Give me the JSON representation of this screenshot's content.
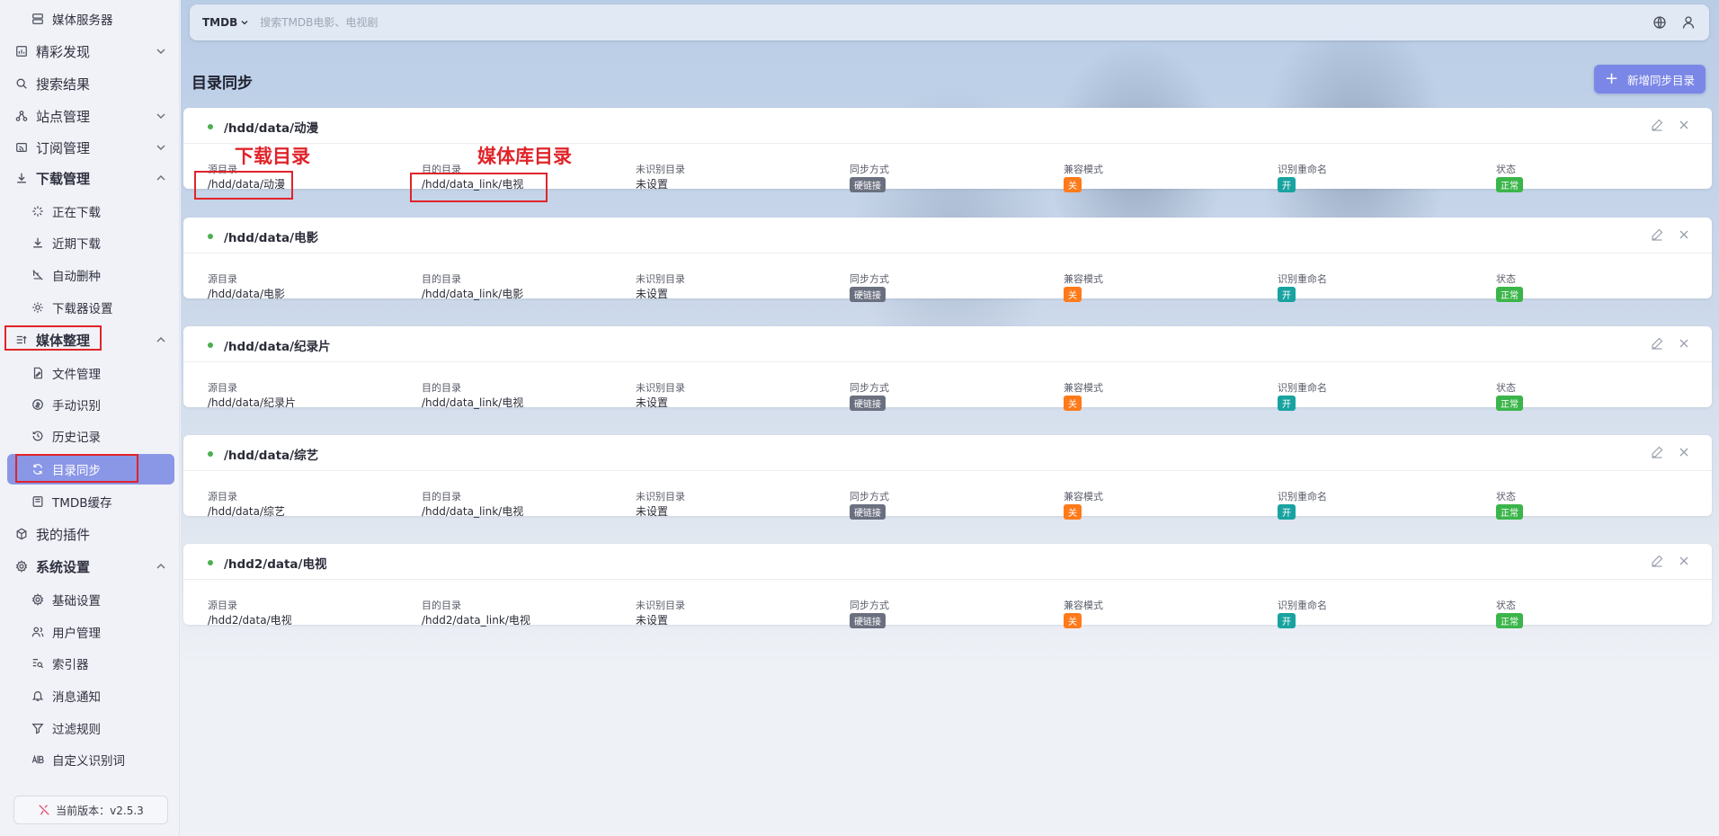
{
  "sidebar": {
    "items": [
      {
        "label": "媒体服务器",
        "icon": "server-icon"
      },
      {
        "label": "精彩发现",
        "icon": "chart-icon"
      },
      {
        "label": "搜索结果",
        "icon": "search-icon"
      },
      {
        "label": "站点管理",
        "icon": "sitemap-icon"
      },
      {
        "label": "订阅管理",
        "icon": "rss-icon"
      },
      {
        "label": "下载管理",
        "icon": "download-icon"
      },
      {
        "label": "正在下载",
        "icon": "loader-icon"
      },
      {
        "label": "近期下载",
        "icon": "download-icon"
      },
      {
        "label": "自动删种",
        "icon": "auto-delete-icon"
      },
      {
        "label": "下载器设置",
        "icon": "downloader-settings-icon"
      },
      {
        "label": "媒体整理",
        "icon": "organize-icon"
      },
      {
        "label": "文件管理",
        "icon": "file-edit-icon"
      },
      {
        "label": "手动识别",
        "icon": "identify-icon"
      },
      {
        "label": "历史记录",
        "icon": "history-icon"
      },
      {
        "label": "目录同步",
        "icon": "sync-icon"
      },
      {
        "label": "TMDB缓存",
        "icon": "cache-icon"
      },
      {
        "label": "我的插件",
        "icon": "plugin-icon"
      },
      {
        "label": "系统设置",
        "icon": "settings-icon"
      },
      {
        "label": "基础设置",
        "icon": "gear-icon"
      },
      {
        "label": "用户管理",
        "icon": "users-icon"
      },
      {
        "label": "索引器",
        "icon": "indexer-icon"
      },
      {
        "label": "消息通知",
        "icon": "bell-icon"
      },
      {
        "label": "过滤规则",
        "icon": "filter-icon"
      },
      {
        "label": "自定义识别词",
        "icon": "ab-icon"
      }
    ],
    "version": "当前版本：v2.5.3"
  },
  "header": {
    "source_select": "TMDB",
    "search_placeholder": "搜索TMDB电影、电视剧"
  },
  "page": {
    "title": "目录同步",
    "add_button": "新增同步目录"
  },
  "field_labels": {
    "source": "源目录",
    "dest": "目的目录",
    "unknown": "未识别目录",
    "sync_mode": "同步方式",
    "compat": "兼容模式",
    "rename": "识别重命名",
    "status": "状态"
  },
  "cards": [
    {
      "title": "/hdd/data/动漫",
      "source": "/hdd/data/动漫",
      "dest": "/hdd/data_link/电视",
      "unknown": "未设置",
      "sync_mode": "硬链接",
      "compat": "关",
      "rename": "开",
      "status": "正常"
    },
    {
      "title": "/hdd/data/电影",
      "source": "/hdd/data/电影",
      "dest": "/hdd/data_link/电影",
      "unknown": "未设置",
      "sync_mode": "硬链接",
      "compat": "关",
      "rename": "开",
      "status": "正常"
    },
    {
      "title": "/hdd/data/纪录片",
      "source": "/hdd/data/纪录片",
      "dest": "/hdd/data_link/电视",
      "unknown": "未设置",
      "sync_mode": "硬链接",
      "compat": "关",
      "rename": "开",
      "status": "正常"
    },
    {
      "title": "/hdd/data/综艺",
      "source": "/hdd/data/综艺",
      "dest": "/hdd/data_link/电视",
      "unknown": "未设置",
      "sync_mode": "硬链接",
      "compat": "关",
      "rename": "开",
      "status": "正常"
    },
    {
      "title": "/hdd2/data/电视",
      "source": "/hdd2/data/电视",
      "dest": "/hdd2/data_link/电视",
      "unknown": "未设置",
      "sync_mode": "硬链接",
      "compat": "关",
      "rename": "开",
      "status": "正常"
    }
  ],
  "annotations": {
    "download_dir": "下载目录",
    "media_lib_dir": "媒体库目录"
  },
  "colors": {
    "accent": "#7b87e6",
    "active_nav": "#8a96e6",
    "annotation": "#e0242a",
    "status_ok": "#3bb54a",
    "compat_off": "#ff7a1a",
    "rename_on": "#19a3a0"
  }
}
